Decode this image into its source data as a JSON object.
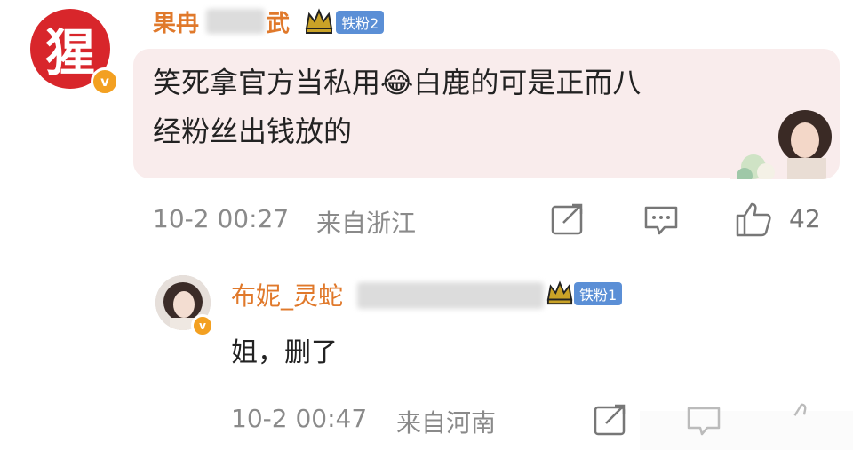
{
  "comment": {
    "avatar_glyph": "猩",
    "verified_badge": "v",
    "username_visible": "果冉",
    "username_trailing": "武",
    "crown_icon": "crown-icon",
    "fan_badge": "铁粉2",
    "text_line1": "笑死拿官方当私用😂白鹿的可是正而八",
    "text_line2": "经粉丝出钱放的",
    "timestamp": "10-2 00:27",
    "location": "来自浙江",
    "like_count": "42",
    "colors": {
      "username": "#e0792b",
      "bubble": "#f9ecec",
      "fan_badge": "#5b8fd6",
      "avatar": "#d8262b"
    }
  },
  "reply": {
    "username_visible": "布妮_灵蛇",
    "fan_badge": "铁粉1",
    "verified_badge": "v",
    "text": "姐，删了",
    "timestamp": "10-2 00:47",
    "location": "来自河南"
  }
}
